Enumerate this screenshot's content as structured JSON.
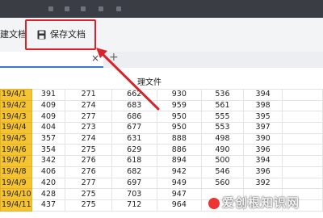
{
  "toolbar": {
    "new_doc_label": "建文档",
    "save_doc_label": "保存文档",
    "save_icon": "floppy-disk-icon"
  },
  "tabs": {
    "close_symbol": "×",
    "add_symbol": "+"
  },
  "document": {
    "title_partial": "理文件"
  },
  "annotation": {
    "highlight_color": "#d8232a"
  },
  "sheet": {
    "date_fill_color": "#f6c431",
    "rows": [
      [
        "19/4/1",
        "391",
        "271",
        "662",
        "930",
        "536",
        "394"
      ],
      [
        "19/4/2",
        "409",
        "274",
        "683",
        "959",
        "561",
        "398"
      ],
      [
        "19/4/3",
        "409",
        "277",
        "686",
        "950",
        "555",
        "395"
      ],
      [
        "19/4/4",
        "404",
        "273",
        "677",
        "950",
        "553",
        "397"
      ],
      [
        "19/4/5",
        "357",
        "274",
        "631",
        "888",
        "498",
        "390"
      ],
      [
        "19/4/6",
        "354",
        "275",
        "629",
        "886",
        "490",
        "396"
      ],
      [
        "19/4/7",
        "342",
        "276",
        "618",
        "894",
        "500",
        "394"
      ],
      [
        "19/4/8",
        "406",
        "276",
        "682",
        "942",
        "546",
        "396"
      ],
      [
        "19/4/9",
        "420",
        "277",
        "697",
        "949",
        "560",
        "392"
      ],
      [
        "19/4/10",
        "428",
        "275",
        "703",
        "947",
        "",
        ""
      ],
      [
        "19/4/11",
        "437",
        "275",
        "712",
        "964",
        "",
        ""
      ]
    ]
  },
  "watermark": {
    "text": "爱创根知识网"
  }
}
